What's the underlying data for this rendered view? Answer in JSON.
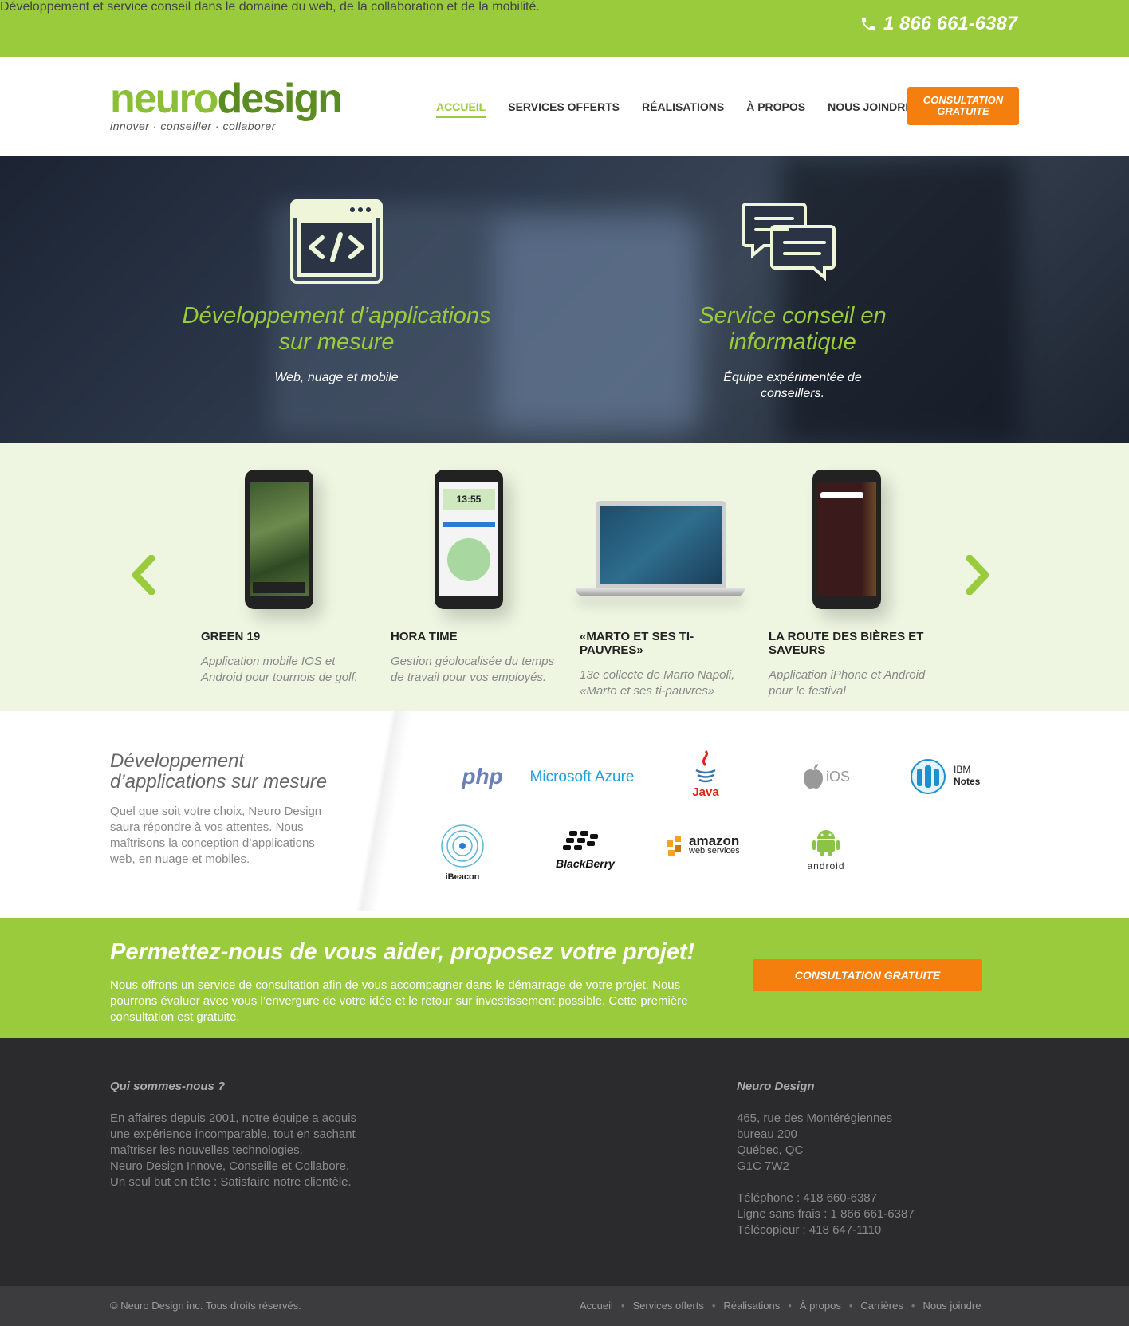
{
  "topbar": {
    "tagline": "Développement et service conseil dans le domaine du web, de la collaboration et de la mobilité.",
    "phone": "1 866 661-6387"
  },
  "header": {
    "logo_part1": "neuro",
    "logo_part2": "design",
    "slogan": "innover · conseiller · collaborer",
    "nav": [
      "ACCUEIL",
      "SERVICES OFFERTS",
      "RÉALISATIONS",
      "À PROPOS",
      "NOUS JOINDRE"
    ],
    "cta": "CONSULTATION GRATUITE"
  },
  "hero": {
    "col1": {
      "title": "Développement d’applications sur mesure",
      "subtitle": "Web, nuage et mobile"
    },
    "col2": {
      "title": "Service conseil en informatique",
      "subtitle": "Équipe expérimentée de conseillers."
    }
  },
  "portfolio": {
    "prev": "‹",
    "next": "›",
    "items": [
      {
        "title": "GREEN 19",
        "desc": "Application mobile IOS et Android pour tournois de golf."
      },
      {
        "title": "HORA TIME",
        "desc": "Gestion géolocalisée du temps de travail pour vos employés."
      },
      {
        "title": "«MARTO ET SES TI-PAUVRES»",
        "desc": "13e collecte de Marto Napoli, «Marto et ses ti-pauvres»"
      },
      {
        "title": "LA ROUTE DES BIÈRES ET SAVEURS",
        "desc": "Application iPhone et Android pour le festival"
      }
    ],
    "screen_text": {
      "hora_clock": "13:55"
    }
  },
  "tech": {
    "title": "Développement d’applications sur mesure",
    "text": "Quel que soit votre choix, Neuro Design saura répondre à vos attentes. Nous maîtrisons la conception d’applications web, en nuage et mobiles.",
    "logos": {
      "php": "php",
      "azure": "Microsoft Azure",
      "java": "Java",
      "ios": "iOS",
      "ibm1": "IBM",
      "ibm2": "Notes",
      "ibeacon": "iBeacon",
      "blackberry": "BlackBerry",
      "amazon1": "amazon",
      "amazon2": "web services",
      "android": "android"
    }
  },
  "cta": {
    "title": "Permettez-nous de vous aider, proposez votre projet!",
    "text": "Nous offrons un service de consultation afin de vous accompagner dans le démarrage de votre projet. Nous pourrons évaluer avec vous l’envergure de votre idée et le retour sur investissement possible. Cette première consultation est gratuite.",
    "button": "CONSULTATION GRATUITE"
  },
  "footer": {
    "about_title": "Qui sommes-nous ?",
    "about_lines": [
      "En affaires depuis 2001, notre équipe a acquis",
      "une expérience incomparable, tout en sachant",
      "maîtriser les nouvelles technologies.",
      "Neuro Design Innove, Conseille et Collabore.",
      "Un seul but en tête : Satisfaire notre clientèle."
    ],
    "company_title": "Neuro Design",
    "address_lines": [
      "465, rue des Montérégiennes",
      "bureau 200",
      "Québec, QC",
      "G1C 7W2"
    ],
    "contact_lines": [
      "Téléphone : 418 660-6387",
      "Ligne sans frais : 1 866 661-6387",
      "Télécopieur : 418 647-1110"
    ],
    "copyright": "© Neuro Design inc. Tous droits réservés.",
    "nav": [
      "Accueil",
      "Services offerts",
      "Réalisations",
      "À propos",
      "Carrières",
      "Nous joindre"
    ]
  },
  "colors": {
    "green": "#9acb3c",
    "orange": "#f47e0e",
    "dark": "#2b2b2d"
  }
}
